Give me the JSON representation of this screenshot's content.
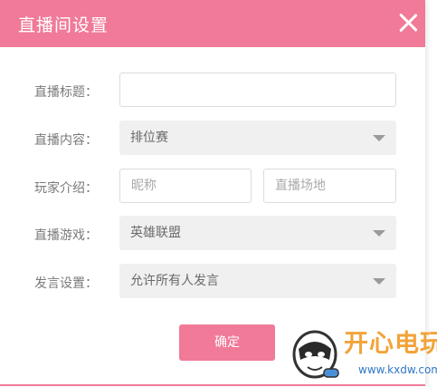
{
  "dialog": {
    "title": "直播间设置",
    "close_icon": "close-icon"
  },
  "form": {
    "title_label": "直播标题：",
    "title_value": "",
    "content_label": "直播内容：",
    "content_selected": "排位赛",
    "player_label": "玩家介绍：",
    "nickname_placeholder": "昵称",
    "location_placeholder": "直播场地",
    "game_label": "直播游戏：",
    "game_selected": "英雄联盟",
    "chat_label": "发言设置：",
    "chat_selected": "允许所有人发言",
    "confirm_label": "确定"
  },
  "watermark": {
    "brand": "开心电玩",
    "url": "www.kxdw.com"
  },
  "colors": {
    "accent": "#f07a97",
    "select_bg": "#f0f0f0",
    "watermark_orange": "#f2a33a",
    "watermark_blue": "#2e76c7"
  }
}
